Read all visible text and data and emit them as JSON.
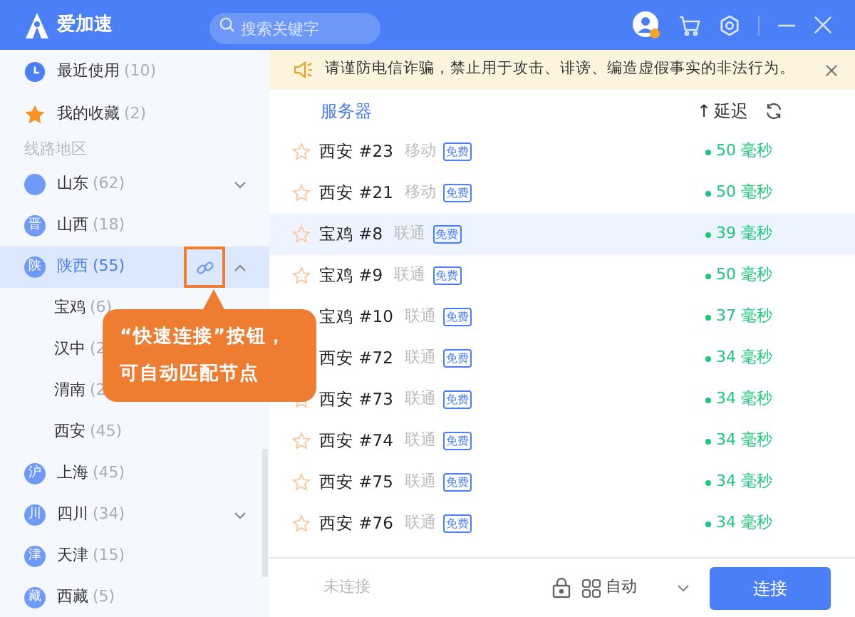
{
  "app": {
    "name": "爱加速",
    "search_placeholder": "搜索关键字"
  },
  "sidebar": {
    "quick": [
      {
        "kind": "recent",
        "label": "最近使用",
        "count": "(10)"
      },
      {
        "kind": "favorites",
        "label": "我的收藏",
        "count": "(2)"
      }
    ],
    "section_title": "线路地区",
    "regions": [
      {
        "label": "山东",
        "count": "(62)",
        "selected": false,
        "expanded": false
      },
      {
        "badge": "晋",
        "label": "山西",
        "count": "(18)",
        "selected": false
      },
      {
        "badge": "陕",
        "label": "陕西",
        "count": "(55)",
        "selected": true,
        "expanded": true,
        "children": [
          {
            "label": "宝鸡",
            "count": "(6)"
          },
          {
            "label": "汉中",
            "count": "(2"
          },
          {
            "label": "渭南",
            "count": "(2"
          },
          {
            "label": "西安",
            "count": "(45)"
          }
        ]
      },
      {
        "badge": "沪",
        "label": "上海",
        "count": "(45)",
        "selected": false
      },
      {
        "badge": "川",
        "label": "四川",
        "count": "(34)",
        "selected": false,
        "expanded": false
      },
      {
        "badge": "津",
        "label": "天津",
        "count": "(15)",
        "selected": false
      },
      {
        "badge": "藏",
        "label": "西藏",
        "count": "(5)",
        "selected": false
      }
    ]
  },
  "notice": {
    "text": "请谨防电信诈骗，禁止用于攻击、诽谤、编造虚假事实的非法行为。"
  },
  "table": {
    "columns": [
      "服务器",
      "延迟"
    ],
    "sort_arrow": "↑",
    "rows": [
      {
        "name": "西安 #23",
        "carrier": "移动",
        "tag": "免费",
        "latency": "50 毫秒",
        "selected": false
      },
      {
        "name": "西安 #21",
        "carrier": "移动",
        "tag": "免费",
        "latency": "50 毫秒",
        "selected": false
      },
      {
        "name": "宝鸡 #8",
        "carrier": "联通",
        "tag": "免费",
        "latency": "39 毫秒",
        "selected": true
      },
      {
        "name": "宝鸡 #9",
        "carrier": "联通",
        "tag": "免费",
        "latency": "50 毫秒",
        "selected": false
      },
      {
        "name": "宝鸡 #10",
        "star": false,
        "carrier": "联通",
        "tag": "免费",
        "latency": "37 毫秒",
        "selected": false
      },
      {
        "name": "西安 #72",
        "star": false,
        "carrier": "联通",
        "tag": "免费",
        "latency": "34 毫秒",
        "selected": false
      },
      {
        "name": "西安 #73",
        "carrier": "联通",
        "tag": "免费",
        "latency": "34 毫秒",
        "selected": false
      },
      {
        "name": "西安 #74",
        "carrier": "联通",
        "tag": "免费",
        "latency": "34 毫秒",
        "selected": false
      },
      {
        "name": "西安 #75",
        "carrier": "联通",
        "tag": "免费",
        "latency": "34 毫秒",
        "selected": false
      },
      {
        "name": "西安 #76",
        "carrier": "联通",
        "tag": "免费",
        "latency": "34 毫秒",
        "selected": false
      }
    ]
  },
  "footer": {
    "status": "未连接",
    "mode": "自动",
    "connect_button": "连接"
  },
  "callout": {
    "lines": [
      "“快速连接”按钮，",
      "可自动匹配节点"
    ]
  }
}
